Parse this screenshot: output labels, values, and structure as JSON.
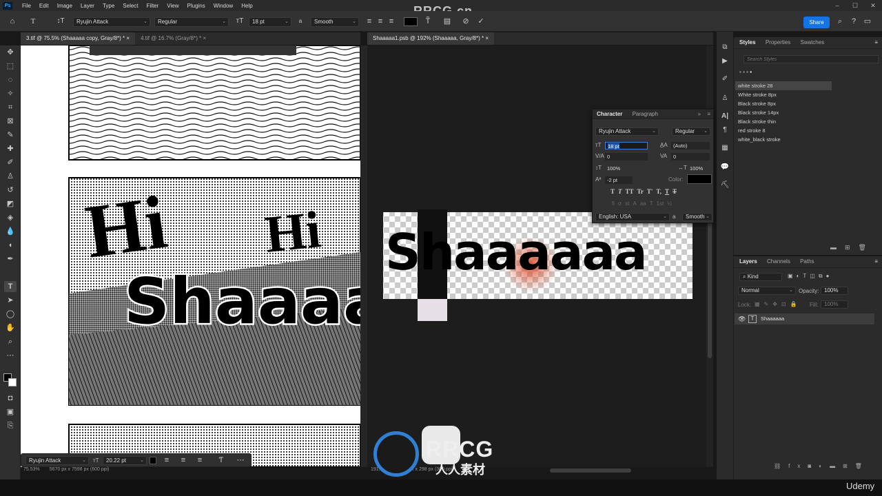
{
  "menu": {
    "items": [
      "File",
      "Edit",
      "Image",
      "Layer",
      "Type",
      "Select",
      "Filter",
      "View",
      "Plugins",
      "Window",
      "Help"
    ],
    "watermark": "RRCG.cn"
  },
  "options": {
    "font_family": "Ryujin Attack",
    "font_style": "Regular",
    "font_size": "18 pt",
    "aa_label": "a",
    "antialias": "Smooth",
    "share_label": "Share",
    "text_color": "#000000"
  },
  "tabs_left": [
    {
      "label": "3.tif @ 75.5% (Shaaaaa copy, Gray/8*) *"
    },
    {
      "label": "4.tif @ 16.7% (Gray/8*) *"
    }
  ],
  "tab_right": {
    "label": "Shaaaaa1.psb @ 192% (Shaaaaa, Gray/8*) *"
  },
  "tab_close": "×",
  "canvas": {
    "left_text_1": "Hi",
    "left_text_2": "Hi",
    "left_text_3": "Shaaaaa",
    "right_text": "Shaaaaaa"
  },
  "styles_panel": {
    "tabs": [
      "Styles",
      "Properties",
      "Swatches"
    ],
    "search_placeholder": "Search Styles",
    "items": [
      "white stroke 28",
      "White stroke 8px",
      "Black stroke 8px",
      "Black stroke 14px",
      "Black stroke thin",
      "red stroke 8",
      "white_black stroke"
    ]
  },
  "character_panel": {
    "tabs": [
      "Character",
      "Paragraph"
    ],
    "font_family": "Ryujin Attack",
    "font_style": "Regular",
    "size": "18 pt",
    "leading": "(Auto)",
    "kerning": "0",
    "tracking": "0",
    "vscale": "100%",
    "hscale": "100%",
    "baseline": "-2 pt",
    "color_label": "Color:",
    "language": "English: USA",
    "aa_label": "a",
    "antialias": "Smooth",
    "style_buttons": [
      "T",
      "T",
      "TT",
      "Tr",
      "T'",
      "T,",
      "T",
      "T"
    ],
    "opentype_buttons": [
      "fi",
      "ơ",
      "st",
      "A",
      "aa",
      "T",
      "1st",
      "½"
    ]
  },
  "layers_panel": {
    "tabs": [
      "Layers",
      "Channels",
      "Paths"
    ],
    "filter": "Kind",
    "blend_mode": "Normal",
    "opacity_label": "Opacity:",
    "opacity": "100%",
    "lock_label": "Lock:",
    "fill_label": "Fill:",
    "fill": "100%",
    "layers": [
      {
        "name": "Shaaaaaa",
        "type": "T"
      }
    ]
  },
  "float_bar": {
    "font_family": "Ryujin Attack",
    "size": "20.22 pt"
  },
  "status": {
    "left_zoom": "75.53%",
    "left_doc": "5670 px x 7598 px (600 ppi)",
    "right_zoom": "191.85%",
    "right_doc": "603 px x 298 px (300 ppi)"
  },
  "bottom_watermark": {
    "title": "RRCG",
    "subtitle": "人人素材",
    "brand": "Udemy"
  }
}
